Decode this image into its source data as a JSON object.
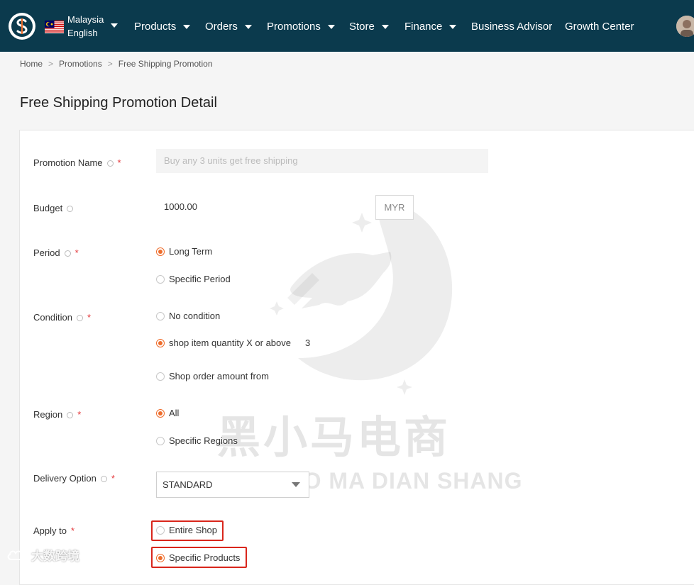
{
  "header": {
    "region": "Malaysia",
    "language": "English",
    "nav": [
      {
        "label": "Products",
        "dropdown": true
      },
      {
        "label": "Orders",
        "dropdown": true
      },
      {
        "label": "Promotions",
        "dropdown": true
      },
      {
        "label": "Store",
        "dropdown": true
      },
      {
        "label": "Finance",
        "dropdown": true
      },
      {
        "label": "Business Advisor",
        "dropdown": false
      },
      {
        "label": "Growth Center",
        "dropdown": false
      }
    ],
    "colors": {
      "bar": "#0b3a4d",
      "accent": "#ee6c2b"
    }
  },
  "breadcrumb": [
    "Home",
    "Promotions",
    "Free Shipping Promotion"
  ],
  "page_title": "Free Shipping Promotion Detail",
  "form": {
    "promotion_name": {
      "label": "Promotion Name",
      "placeholder": "Buy any 3 units get free shipping"
    },
    "budget": {
      "label": "Budget",
      "value": "1000.00",
      "currency": "MYR"
    },
    "period": {
      "label": "Period",
      "options": [
        "Long Term",
        "Specific Period"
      ],
      "selected": "Long Term"
    },
    "condition": {
      "label": "Condition",
      "options": [
        "No condition",
        "shop item quantity X or above",
        "Shop order amount from"
      ],
      "selected": "shop item quantity X or above",
      "quantity": "3"
    },
    "region": {
      "label": "Region",
      "options": [
        "All",
        "Specific Regions"
      ],
      "selected": "All"
    },
    "delivery_option": {
      "label": "Delivery Option",
      "value": "STANDARD"
    },
    "apply_to": {
      "label": "Apply to",
      "options": [
        "Entire Shop",
        "Specific Products"
      ],
      "selected": "Specific Products"
    }
  },
  "watermark": {
    "chinese": "黑小马电商",
    "english": "HEI XIAO MA DIAN SHANG",
    "corner": "大数跨境"
  }
}
